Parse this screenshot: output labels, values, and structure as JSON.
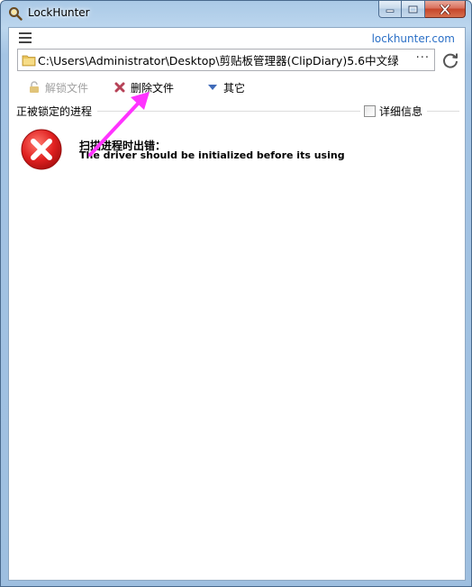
{
  "window": {
    "title": "LockHunter"
  },
  "header": {
    "site_link": "lockhunter.com"
  },
  "path": {
    "value": "C:\\Users\\Administrator\\Desktop\\剪贴板管理器(ClipDiary)5.6中文绿",
    "more_label": "···"
  },
  "toolbar": {
    "unlock_label": "解锁文件",
    "delete_label": "删除文件",
    "other_label": "其它"
  },
  "list": {
    "section_label": "正被锁定的进程",
    "details_label": "详细信息",
    "details_checked": false
  },
  "error": {
    "title": "扫描进程时出错：",
    "message": "The driver should be initialized before its using"
  },
  "colors": {
    "link": "#2a6fc6",
    "error_red": "#e02020",
    "annotation_arrow": "#ff33ff"
  }
}
